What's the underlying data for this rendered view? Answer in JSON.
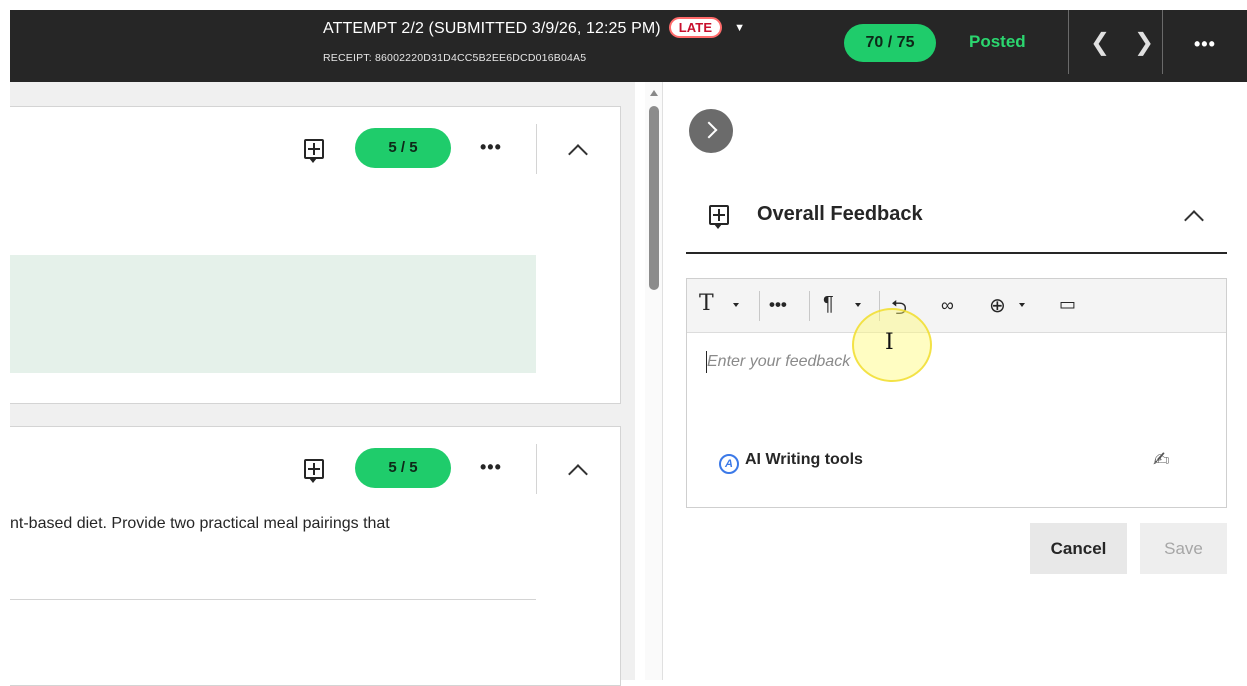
{
  "header": {
    "attempt": "ATTEMPT 2/2 (SUBMITTED 3/9/26, 12:25 PM)",
    "late_badge": "LATE",
    "receipt": "RECEIPT: 86002220D31D4CC5B2EE6DCD016B04A5",
    "total_score": "70 / 75",
    "status": "Posted",
    "more": "•••",
    "prev_icon": "chevron-left-icon",
    "next_icon": "chevron-right-icon"
  },
  "questions": [
    {
      "score": "5 / 5",
      "more": "•••",
      "text": ""
    },
    {
      "score": "5 / 5",
      "more": "•••",
      "text": "nt-based diet. Provide two practical meal pairings that"
    }
  ],
  "feedback": {
    "title": "Overall Feedback",
    "placeholder": "Enter your feedback",
    "ai_tools": "AI Writing tools",
    "cancel": "Cancel",
    "save": "Save"
  },
  "colors": {
    "header_bg": "#262626",
    "score_green": "#1fcc6b",
    "posted_green": "#2bd66f",
    "late_red": "#c8102e",
    "answer_bg": "#e5f1ea"
  }
}
